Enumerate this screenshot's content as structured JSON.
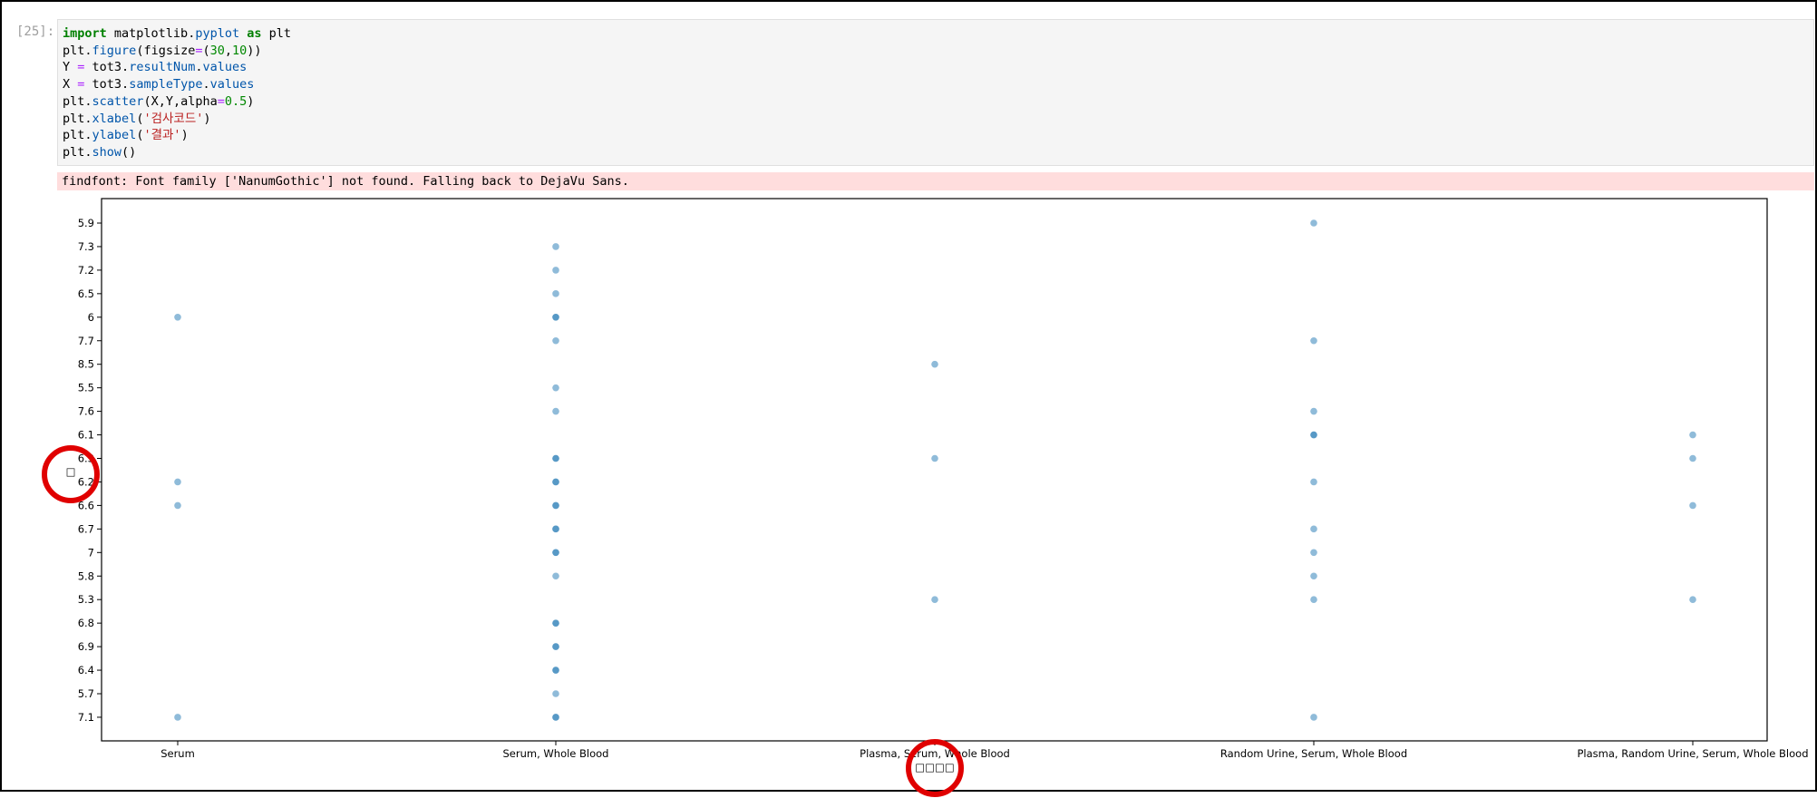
{
  "cell": {
    "prompt": "[25]:",
    "code_lines": [
      [
        {
          "t": "import",
          "c": "kw"
        },
        {
          "t": " matplotlib",
          "c": ""
        },
        {
          "t": ".",
          "c": ""
        },
        {
          "t": "pyplot",
          "c": "fn"
        },
        {
          "t": " ",
          "c": ""
        },
        {
          "t": "as",
          "c": "kw"
        },
        {
          "t": " plt",
          "c": ""
        }
      ],
      [
        {
          "t": "plt",
          "c": ""
        },
        {
          "t": ".",
          "c": ""
        },
        {
          "t": "figure",
          "c": "fn"
        },
        {
          "t": "(figsize",
          "c": ""
        },
        {
          "t": "=",
          "c": "op"
        },
        {
          "t": "(",
          "c": ""
        },
        {
          "t": "30",
          "c": "num"
        },
        {
          "t": ",",
          "c": ""
        },
        {
          "t": "10",
          "c": "num"
        },
        {
          "t": "))",
          "c": ""
        }
      ],
      [
        {
          "t": "Y ",
          "c": ""
        },
        {
          "t": "=",
          "c": "op"
        },
        {
          "t": " tot3",
          "c": ""
        },
        {
          "t": ".",
          "c": ""
        },
        {
          "t": "resultNum",
          "c": "fn"
        },
        {
          "t": ".",
          "c": ""
        },
        {
          "t": "values",
          "c": "fn"
        }
      ],
      [
        {
          "t": "X ",
          "c": ""
        },
        {
          "t": "=",
          "c": "op"
        },
        {
          "t": " tot3",
          "c": ""
        },
        {
          "t": ".",
          "c": ""
        },
        {
          "t": "sampleType",
          "c": "fn"
        },
        {
          "t": ".",
          "c": ""
        },
        {
          "t": "values",
          "c": "fn"
        }
      ],
      [
        {
          "t": "plt",
          "c": ""
        },
        {
          "t": ".",
          "c": ""
        },
        {
          "t": "scatter",
          "c": "fn"
        },
        {
          "t": "(X,Y,alpha",
          "c": ""
        },
        {
          "t": "=",
          "c": "op"
        },
        {
          "t": "0.5",
          "c": "num"
        },
        {
          "t": ")",
          "c": ""
        }
      ],
      [
        {
          "t": "plt",
          "c": ""
        },
        {
          "t": ".",
          "c": ""
        },
        {
          "t": "xlabel",
          "c": "fn"
        },
        {
          "t": "(",
          "c": ""
        },
        {
          "t": "'검사코드'",
          "c": "str"
        },
        {
          "t": ")",
          "c": ""
        }
      ],
      [
        {
          "t": "plt",
          "c": ""
        },
        {
          "t": ".",
          "c": ""
        },
        {
          "t": "ylabel",
          "c": "fn"
        },
        {
          "t": "(",
          "c": ""
        },
        {
          "t": "'결과'",
          "c": "str"
        },
        {
          "t": ")",
          "c": ""
        }
      ],
      [
        {
          "t": "plt",
          "c": ""
        },
        {
          "t": ".",
          "c": ""
        },
        {
          "t": "show",
          "c": "fn"
        },
        {
          "t": "()",
          "c": ""
        }
      ]
    ],
    "stderr": "findfont: Font family ['NanumGothic'] not found. Falling back to DejaVu Sans."
  },
  "chart_data": {
    "type": "scatter",
    "xlabel": "□□□□",
    "ylabel": "□",
    "categories": [
      "Serum",
      "Serum, Whole Blood",
      "Plasma, Serum, Whole Blood",
      "Random Urine, Serum, Whole Blood",
      "Plasma, Random Urine, Serum, Whole Blood"
    ],
    "y_ticks": [
      "5.9",
      "7.3",
      "7.2",
      "6.5",
      "6",
      "7.7",
      "8.5",
      "5.5",
      "7.6",
      "6.1",
      "6.3",
      "6.2",
      "6.6",
      "6.7",
      "7",
      "5.8",
      "5.3",
      "6.8",
      "6.9",
      "6.4",
      "5.7",
      "7.1"
    ],
    "points": [
      {
        "x": "Serum",
        "y": "6"
      },
      {
        "x": "Serum",
        "y": "6.2"
      },
      {
        "x": "Serum",
        "y": "6.6"
      },
      {
        "x": "Serum",
        "y": "7.1"
      },
      {
        "x": "Serum, Whole Blood",
        "y": "7.3"
      },
      {
        "x": "Serum, Whole Blood",
        "y": "7.2"
      },
      {
        "x": "Serum, Whole Blood",
        "y": "6.5"
      },
      {
        "x": "Serum, Whole Blood",
        "y": "6"
      },
      {
        "x": "Serum, Whole Blood",
        "y": "6"
      },
      {
        "x": "Serum, Whole Blood",
        "y": "7.7"
      },
      {
        "x": "Serum, Whole Blood",
        "y": "5.5"
      },
      {
        "x": "Serum, Whole Blood",
        "y": "7.6"
      },
      {
        "x": "Serum, Whole Blood",
        "y": "6.3"
      },
      {
        "x": "Serum, Whole Blood",
        "y": "6.3"
      },
      {
        "x": "Serum, Whole Blood",
        "y": "6.2"
      },
      {
        "x": "Serum, Whole Blood",
        "y": "6.2"
      },
      {
        "x": "Serum, Whole Blood",
        "y": "6.6"
      },
      {
        "x": "Serum, Whole Blood",
        "y": "6.6"
      },
      {
        "x": "Serum, Whole Blood",
        "y": "6.7"
      },
      {
        "x": "Serum, Whole Blood",
        "y": "6.7"
      },
      {
        "x": "Serum, Whole Blood",
        "y": "7"
      },
      {
        "x": "Serum, Whole Blood",
        "y": "7"
      },
      {
        "x": "Serum, Whole Blood",
        "y": "5.8"
      },
      {
        "x": "Serum, Whole Blood",
        "y": "6.8"
      },
      {
        "x": "Serum, Whole Blood",
        "y": "6.8"
      },
      {
        "x": "Serum, Whole Blood",
        "y": "6.9"
      },
      {
        "x": "Serum, Whole Blood",
        "y": "6.9"
      },
      {
        "x": "Serum, Whole Blood",
        "y": "6.4"
      },
      {
        "x": "Serum, Whole Blood",
        "y": "6.4"
      },
      {
        "x": "Serum, Whole Blood",
        "y": "5.7"
      },
      {
        "x": "Serum, Whole Blood",
        "y": "7.1"
      },
      {
        "x": "Serum, Whole Blood",
        "y": "7.1"
      },
      {
        "x": "Plasma, Serum, Whole Blood",
        "y": "8.5"
      },
      {
        "x": "Plasma, Serum, Whole Blood",
        "y": "6.3"
      },
      {
        "x": "Plasma, Serum, Whole Blood",
        "y": "5.3"
      },
      {
        "x": "Random Urine, Serum, Whole Blood",
        "y": "5.9"
      },
      {
        "x": "Random Urine, Serum, Whole Blood",
        "y": "7.7"
      },
      {
        "x": "Random Urine, Serum, Whole Blood",
        "y": "7.6"
      },
      {
        "x": "Random Urine, Serum, Whole Blood",
        "y": "6.1"
      },
      {
        "x": "Random Urine, Serum, Whole Blood",
        "y": "6.1"
      },
      {
        "x": "Random Urine, Serum, Whole Blood",
        "y": "6.2"
      },
      {
        "x": "Random Urine, Serum, Whole Blood",
        "y": "6.7"
      },
      {
        "x": "Random Urine, Serum, Whole Blood",
        "y": "7"
      },
      {
        "x": "Random Urine, Serum, Whole Blood",
        "y": "5.8"
      },
      {
        "x": "Random Urine, Serum, Whole Blood",
        "y": "5.3"
      },
      {
        "x": "Random Urine, Serum, Whole Blood",
        "y": "7.1"
      },
      {
        "x": "Plasma, Random Urine, Serum, Whole Blood",
        "y": "6.1"
      },
      {
        "x": "Plasma, Random Urine, Serum, Whole Blood",
        "y": "6.3"
      },
      {
        "x": "Plasma, Random Urine, Serum, Whole Blood",
        "y": "6.6"
      },
      {
        "x": "Plasma, Random Urine, Serum, Whole Blood",
        "y": "5.3"
      }
    ],
    "marker_color": "#1f77b4",
    "alpha": 0.5,
    "grid": false,
    "annotation_color": "#e00000"
  }
}
